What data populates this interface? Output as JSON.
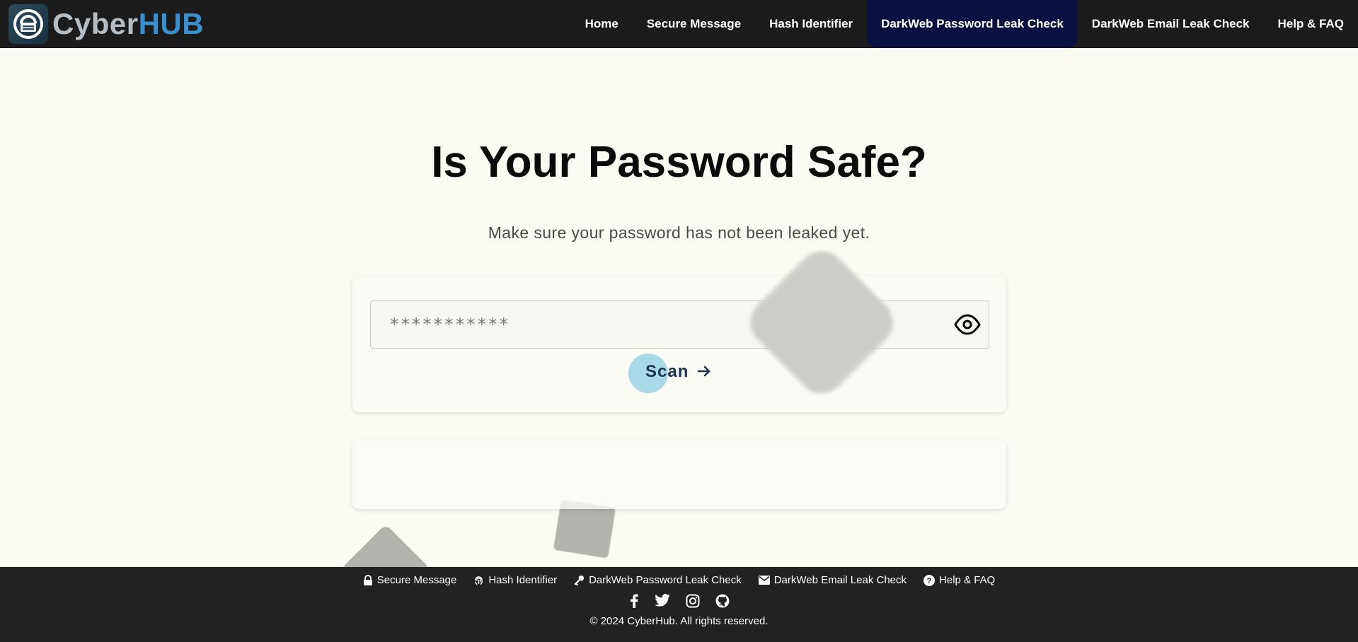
{
  "brand": {
    "name_part1": "Cyber",
    "name_part2": "HUB"
  },
  "nav": {
    "items": [
      {
        "label": "Home"
      },
      {
        "label": "Secure Message"
      },
      {
        "label": "Hash Identifier"
      },
      {
        "label": "DarkWeb Password Leak Check",
        "active": true
      },
      {
        "label": "DarkWeb Email Leak Check"
      },
      {
        "label": "Help & FAQ"
      }
    ]
  },
  "hero": {
    "title": "Is Your Password Safe?",
    "subtitle": "Make sure your password has not been leaked yet."
  },
  "form": {
    "placeholder": "***********",
    "scan_label": "Scan"
  },
  "footer": {
    "links": [
      {
        "label": "Secure Message",
        "icon": "lock-icon"
      },
      {
        "label": "Hash Identifier",
        "icon": "fingerprint-icon"
      },
      {
        "label": "DarkWeb Password Leak Check",
        "icon": "key-icon"
      },
      {
        "label": "DarkWeb Email Leak Check",
        "icon": "envelope-icon"
      },
      {
        "label": "Help & FAQ",
        "icon": "question-circle-icon"
      }
    ],
    "social": [
      "facebook-icon",
      "twitter-icon",
      "instagram-icon",
      "github-icon"
    ],
    "copyright": "© 2024 CyberHub. All rights reserved."
  },
  "colors": {
    "navbar_bg": "#1b1b1b",
    "nav_active_bg": "#0a1140",
    "page_bg": "#fbfbf3",
    "brand_accent": "#3a8fcf",
    "scan_accent": "#a9d8e8",
    "footer_bg": "#222222"
  }
}
